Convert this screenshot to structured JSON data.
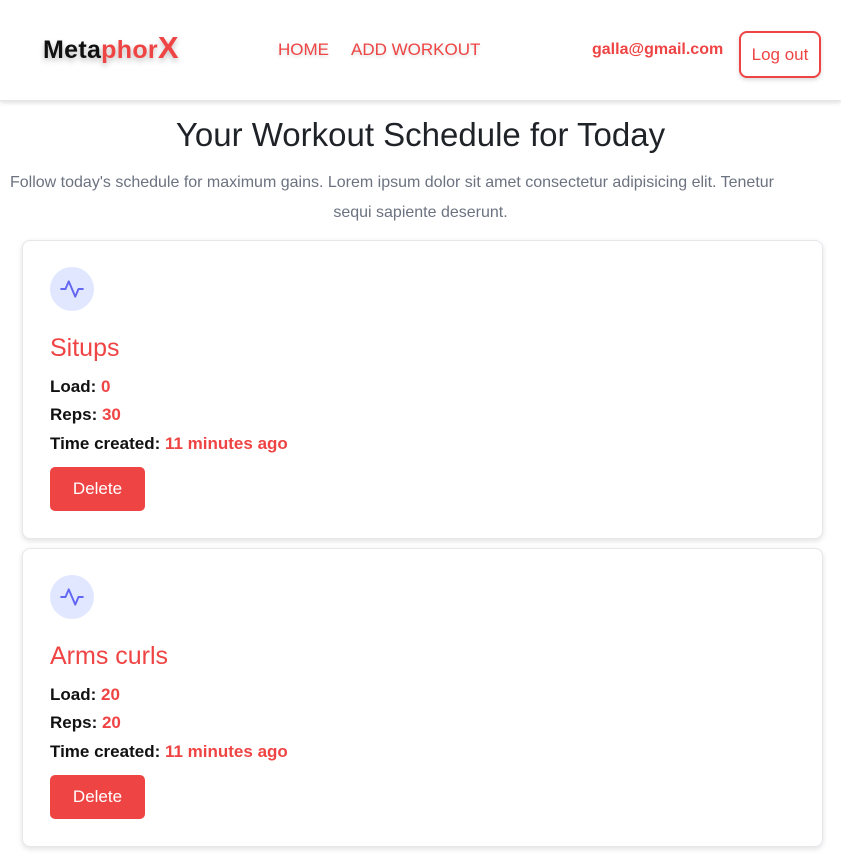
{
  "nav": {
    "brand": {
      "part1": "Meta",
      "part2": "phor",
      "part3": "X"
    },
    "links": [
      {
        "label": "HOME"
      },
      {
        "label": "ADD WORKOUT"
      }
    ],
    "user_email": "galla@gmail.com",
    "logout_label": "Log out"
  },
  "main": {
    "title": "Your Workout Schedule for Today",
    "subtitle_line1": "Follow today's schedule for maximum gains. Lorem ipsum dolor sit amet consectetur adipisicing elit. Tenetur",
    "subtitle_line2": "sequi sapiente deserunt."
  },
  "labels": {
    "load": "Load:",
    "reps": "Reps:",
    "time_created": "Time created:",
    "delete": "Delete"
  },
  "workouts": [
    {
      "name": "Situps",
      "load": "0",
      "reps": "30",
      "time_created": "11 minutes ago",
      "icon": "activity-icon"
    },
    {
      "name": "Arms curls",
      "load": "20",
      "reps": "20",
      "time_created": "11 minutes ago",
      "icon": "activity-icon"
    }
  ],
  "colors": {
    "accent": "#ef4444",
    "icon": "#6366f1",
    "icon_bg": "#e0e7ff"
  }
}
